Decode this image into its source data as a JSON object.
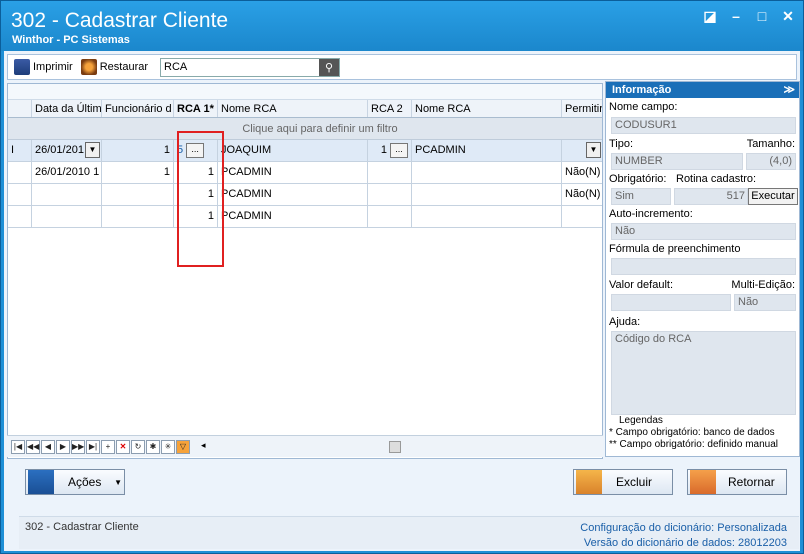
{
  "window": {
    "title": "302 - Cadastrar Cliente",
    "subtitle": "Winthor - PC Sistemas",
    "controls": [
      "pin-icon",
      "minimize-icon",
      "maximize-icon",
      "close-icon"
    ]
  },
  "toolbar": {
    "print_label": "Imprimir",
    "restore_label": "Restaurar",
    "search_value": "RCA"
  },
  "grid": {
    "columns": [
      "Data da Últim",
      "Funcionário d",
      "RCA 1*",
      "Nome RCA",
      "RCA 2",
      "Nome RCA",
      "Permitir"
    ],
    "filter_placeholder": "Clique aqui para definir um filtro",
    "rows": [
      {
        "date": "26/01/201",
        "func": "1",
        "rca1": "5",
        "nome1": "JOAQUIM",
        "rca2": "1",
        "nome2": "PCADMIN",
        "perm": ""
      },
      {
        "date": "26/01/2010 1",
        "func": "1",
        "rca1": "1",
        "nome1": "PCADMIN",
        "rca2": "",
        "nome2": "",
        "perm": "Não(N)"
      },
      {
        "date": "",
        "func": "",
        "rca1": "1",
        "nome1": "PCADMIN",
        "rca2": "",
        "nome2": "",
        "perm": "Não(N)"
      },
      {
        "date": "",
        "func": "",
        "rca1": "1",
        "nome1": "PCADMIN",
        "rca2": "",
        "nome2": "",
        "perm": ""
      }
    ]
  },
  "panel": {
    "title": "Informação",
    "nome_campo_label": "Nome campo:",
    "nome_campo": "CODUSUR1",
    "tipo_label": "Tipo:",
    "tamanho_label": "Tamanho:",
    "tipo": "NUMBER",
    "tamanho": "(4,0)",
    "obrigatorio_label": "Obrigatório:",
    "rotina_label": "Rotina cadastro:",
    "obrigatorio": "Sim",
    "rotina": "517",
    "executar_label": "Executar",
    "auto_label": "Auto-incremento:",
    "auto": "Não",
    "formula_label": "Fórmula de preenchimento",
    "formula": "",
    "valor_label": "Valor default:",
    "multi_label": "Multi-Edição:",
    "valor": "",
    "multi": "Não",
    "ajuda_label": "Ajuda:",
    "ajuda": "Código do RCA",
    "legendas_label": "Legendas",
    "legend1": "* Campo obrigatório: banco de dados",
    "legend2": "** Campo obrigatório: definido manual"
  },
  "actions": {
    "acoes_label": "Ações",
    "excluir_label": "Excluir",
    "retornar_label": "Retornar"
  },
  "status": {
    "left": "302 - Cadastrar Cliente",
    "config_label": "Configuração do dicionário:",
    "config_value": "Personalizada",
    "version_label": "Versão do dicionário de dados:",
    "version_value": "28012203"
  }
}
